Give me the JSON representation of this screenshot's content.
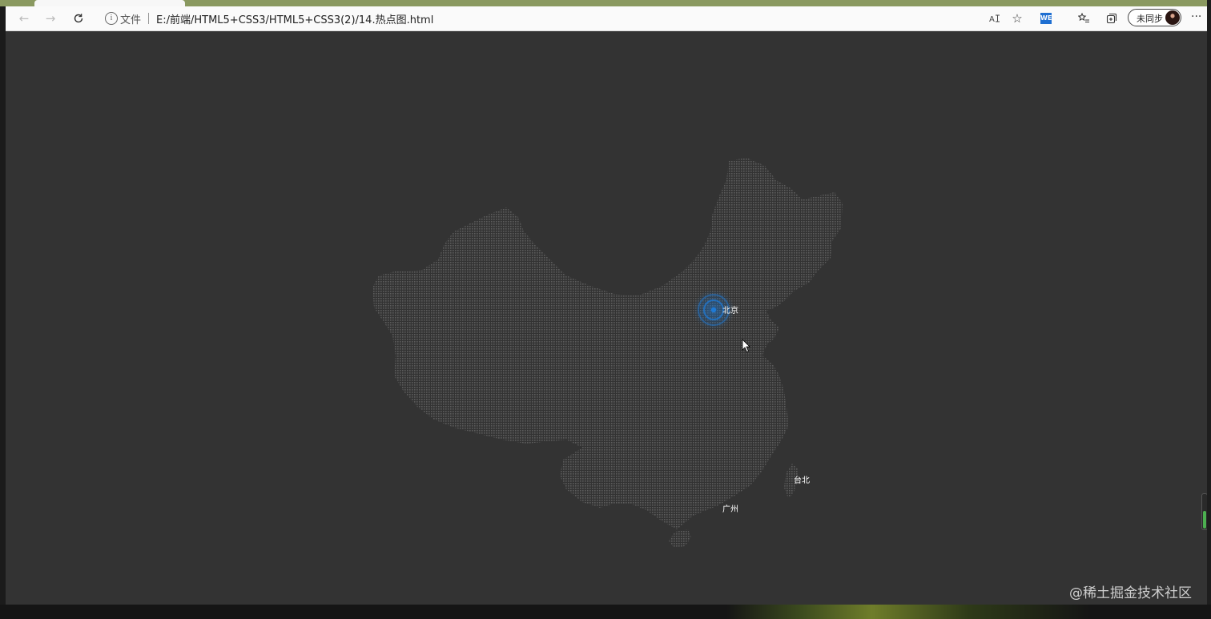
{
  "browser": {
    "address": {
      "info_icon": "info-icon",
      "label": "文件",
      "url": "E:/前端/HTML5+CSS3/HTML5+CSS3(2)/14.热点图.html"
    },
    "toolbar": {
      "back_icon": "back-arrow-icon",
      "forward_icon": "forward-arrow-icon",
      "refresh_icon": "refresh-icon",
      "read_aloud_icon": "read-aloud-icon",
      "favorite_icon": "star-icon",
      "extension_label": "WE",
      "favorites_list_icon": "favorites-list-icon",
      "collections_icon": "collections-icon",
      "sync_label": "未同步",
      "more_icon": "ellipsis-icon"
    }
  },
  "map": {
    "colors": {
      "background": "#333333",
      "dots": "#5c5c5c",
      "hotspot": "#1e7ad6",
      "label": "#ffffff"
    },
    "cities": [
      {
        "name": "北京",
        "hotspot": true
      },
      {
        "name": "台北",
        "hotspot": false
      },
      {
        "name": "广州",
        "hotspot": false
      }
    ]
  },
  "watermark": "@稀土掘金技术社区"
}
